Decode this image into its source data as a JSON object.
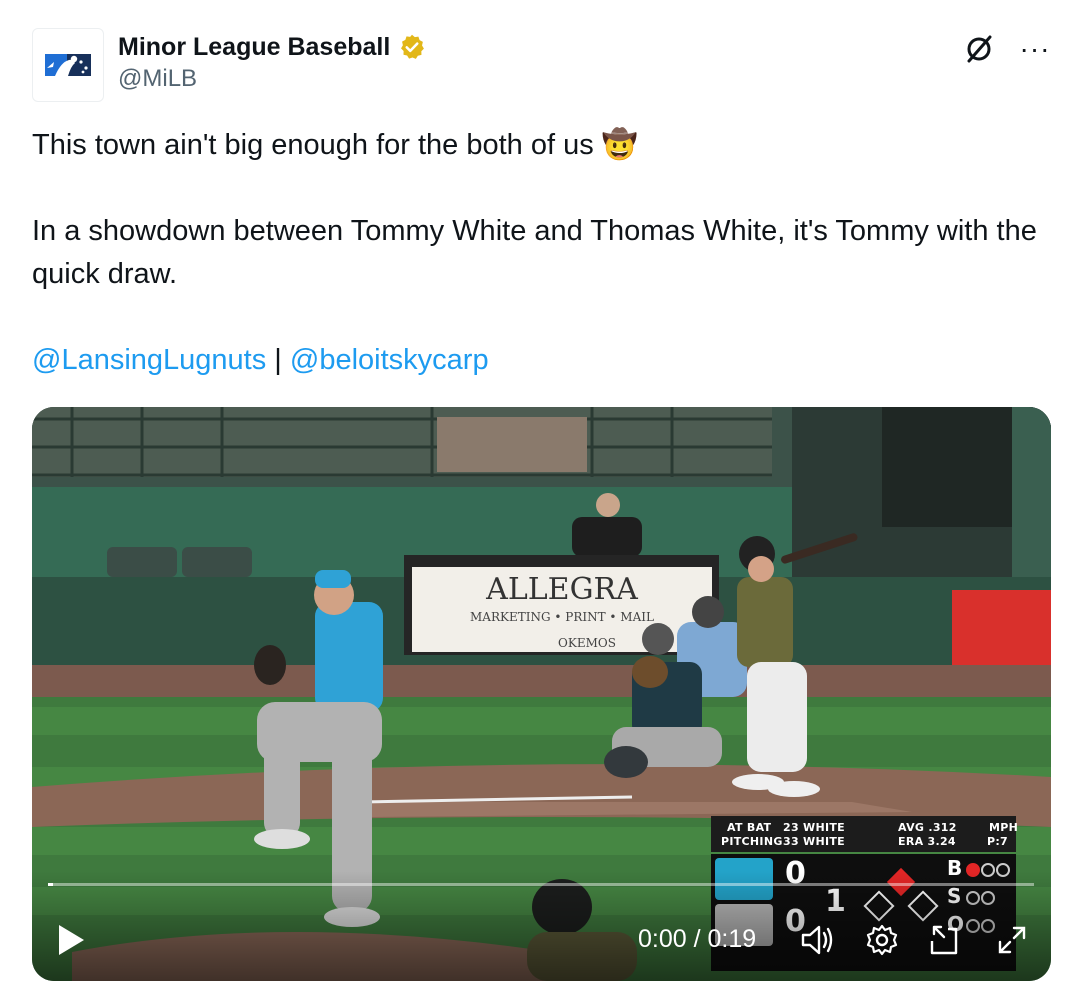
{
  "account": {
    "display_name": "Minor League Baseball",
    "handle": "@MiLB",
    "verified_color": "#e2b719",
    "logo_icon": "milb-logo-icon"
  },
  "header_actions": {
    "grok_icon": "slash-circle-icon",
    "more_label": "···"
  },
  "tweet": {
    "line1": "This town ain't big enough for the both of us 🤠",
    "line2": "In a showdown between Tommy White and Thomas White, it's Tommy with the quick draw.",
    "mention1": "@LansingLugnuts",
    "separator": " | ",
    "mention2": "@beloitskycarp"
  },
  "scene": {
    "banner_title": "ALLEGRA",
    "banner_sub": "MARKETING • PRINT • MAIL",
    "banner_city": "OKEMOS"
  },
  "scorebug": {
    "at_bat_label": "AT BAT",
    "pitching_label": "PITCHING",
    "batter": "23 WHITE",
    "pitcher": "33 WHITE",
    "avg": "AVG .312",
    "era": "ERA 3.24",
    "mph_label": "MPH",
    "pitch_count": "P:7",
    "home_score": "0",
    "away_score": "0",
    "inning": "1",
    "balls_label": "B",
    "strikes_label": "S",
    "outs_label": "O"
  },
  "video": {
    "time": "0:00 / 0:19",
    "progress": 0.005,
    "colors": {
      "accent": "#1d9bf0",
      "handle": "#536471"
    }
  }
}
